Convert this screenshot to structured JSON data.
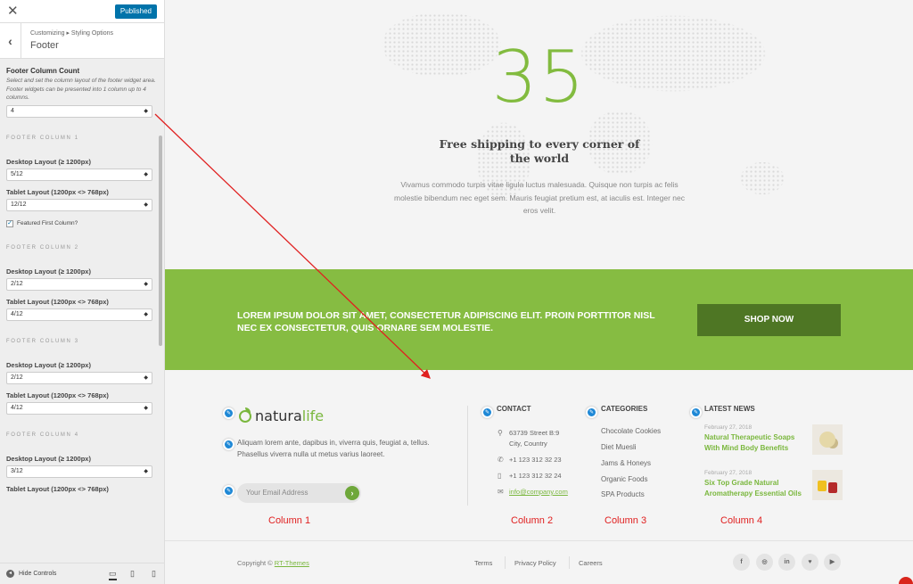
{
  "sidebar": {
    "close_label": "✕",
    "publish_label": "Published",
    "back_label": "‹",
    "breadcrumb": "Customizing ▸ Styling Options",
    "section_title": "Footer",
    "footer_column_count": {
      "title": "Footer Column Count",
      "description": "Select and set the column layout of the footer widget area. Footer widgets can be presented into 1 column up to 4 columns.",
      "value": "4"
    },
    "columns": [
      {
        "heading": "FOOTER COLUMN 1",
        "desktop_label": "Desktop Layout (≥ 1200px)",
        "desktop_value": "5/12",
        "tablet_label": "Tablet Layout (1200px <> 768px)",
        "tablet_value": "12/12",
        "checkbox_label": "Featured First Column?"
      },
      {
        "heading": "FOOTER COLUMN 2",
        "desktop_label": "Desktop Layout (≥ 1200px)",
        "desktop_value": "2/12",
        "tablet_label": "Tablet Layout (1200px <> 768px)",
        "tablet_value": "4/12"
      },
      {
        "heading": "FOOTER COLUMN 3",
        "desktop_label": "Desktop Layout (≥ 1200px)",
        "desktop_value": "2/12",
        "tablet_label": "Tablet Layout (1200px <> 768px)",
        "tablet_value": "4/12"
      },
      {
        "heading": "FOOTER COLUMN 4",
        "desktop_label": "Desktop Layout (≥ 1200px)",
        "desktop_value": "3/12",
        "tablet_label": "Tablet Layout (1200px <> 768px)"
      }
    ],
    "hide_controls_label": "Hide Controls",
    "devices": [
      "desktop-icon",
      "tablet-icon",
      "mobile-icon"
    ]
  },
  "hero": {
    "number": "35",
    "title": "Free shipping to every corner of the world",
    "text": "Vivamus commodo turpis vitae ligula luctus malesuada. Quisque non turpis ac felis molestie bibendum nec eget sem. Mauris feugiat pretium est, at iaculis est. Integer nec eros velit."
  },
  "banner": {
    "text": "LOREM IPSUM DOLOR SIT AMET, CONSECTETUR ADIPISCING ELIT. PROIN PORTTITOR NISL NEC EX CONSECTETUR, QUIS ORNARE SEM MOLESTIE.",
    "button_label": "SHOP NOW"
  },
  "footer": {
    "logo_part1": "natura",
    "logo_part2": "life",
    "about": "Aliquam lorem ante, dapibus in, viverra quis, feugiat a, tellus. Phasellus viverra nulla ut metus varius laoreet.",
    "email_placeholder": "Your Email Address",
    "contact": {
      "title": "CONTACT",
      "address_line1": "63739 Street B:9",
      "address_line2": "City, Country",
      "phone": "+1 123 312 32 23",
      "mobile": "+1 123 312 32 24",
      "email": "info@company.com"
    },
    "categories": {
      "title": "CATEGORIES",
      "items": [
        "Chocolate Cookies",
        "Diet Muesli",
        "Jams & Honeys",
        "Organic Foods",
        "SPA Products"
      ]
    },
    "news": {
      "title": "LATEST NEWS",
      "items": [
        {
          "date": "February 27, 2018",
          "title": "Natural Therapeutic Soaps With Mind Body Benefits"
        },
        {
          "date": "February 27, 2018",
          "title": "Six Top Grade Natural Aromatherapy Essential Oils"
        }
      ]
    },
    "column_labels": [
      "Column 1",
      "Column 2",
      "Column 3",
      "Column 4"
    ],
    "copyright_prefix": "Copyright © ",
    "copyright_link": "RT-Themes",
    "links": [
      "Terms",
      "Privacy Policy",
      "Careers"
    ],
    "social": [
      "f",
      "◎",
      "in",
      "♥",
      "▶"
    ]
  },
  "colors": {
    "accent_green": "#86bc42",
    "dark_green": "#4e7624",
    "annotation_red": "#e02020",
    "wp_blue": "#0073aa"
  }
}
